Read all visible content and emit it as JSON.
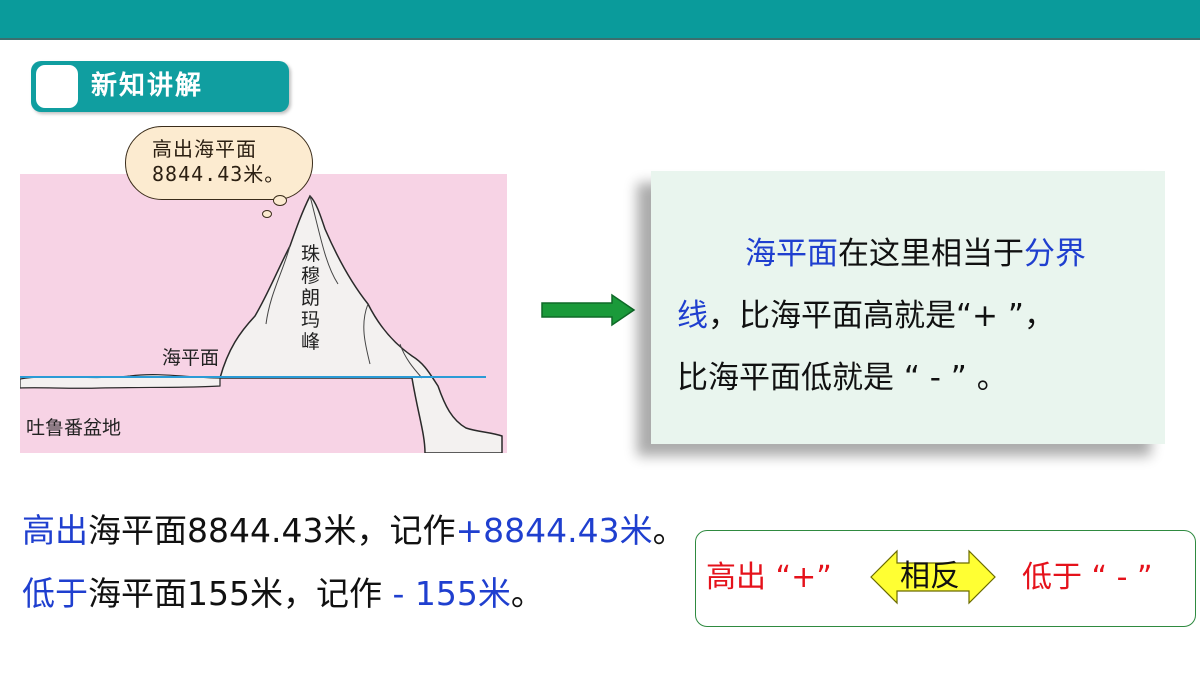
{
  "header": {
    "section_tag": "新知讲解"
  },
  "illustration": {
    "bubble_line1": "高出海平面",
    "bubble_line2": "8844.43米。",
    "peak_label": "珠穆朗玛峰",
    "sea_label": "海平面",
    "basin_label": "吐鲁番盆地",
    "colors": {
      "background": "#f7d3e5",
      "sea_line": "#2b9bd6"
    }
  },
  "note": {
    "p1": "海平面",
    "p2": "在这里相当于",
    "p3": "分界线",
    "p4": "，比海平面高就是“+ ”，",
    "p5": "比海平面低就是 “ - ” 。"
  },
  "statements": {
    "line1_a": "高出",
    "line1_b": "海平面8844.43米，记作",
    "line1_c": "+8844.43米",
    "line1_d": "。",
    "line2_a": "低于",
    "line2_b": "海平面155米，记作 ",
    "line2_c": "- 155米",
    "line2_d": "。"
  },
  "opposite": {
    "left": "高出 “+”",
    "middle": "相反",
    "right": "低于 “ - ”"
  },
  "colors": {
    "accent_teal": "#0a9b9b",
    "blue_text": "#1f3fcf",
    "red_text": "#e5121b",
    "note_bg": "#e9f5ee",
    "arrow_green": "#1a9a3a",
    "double_arrow_yellow": "#ffff33"
  }
}
